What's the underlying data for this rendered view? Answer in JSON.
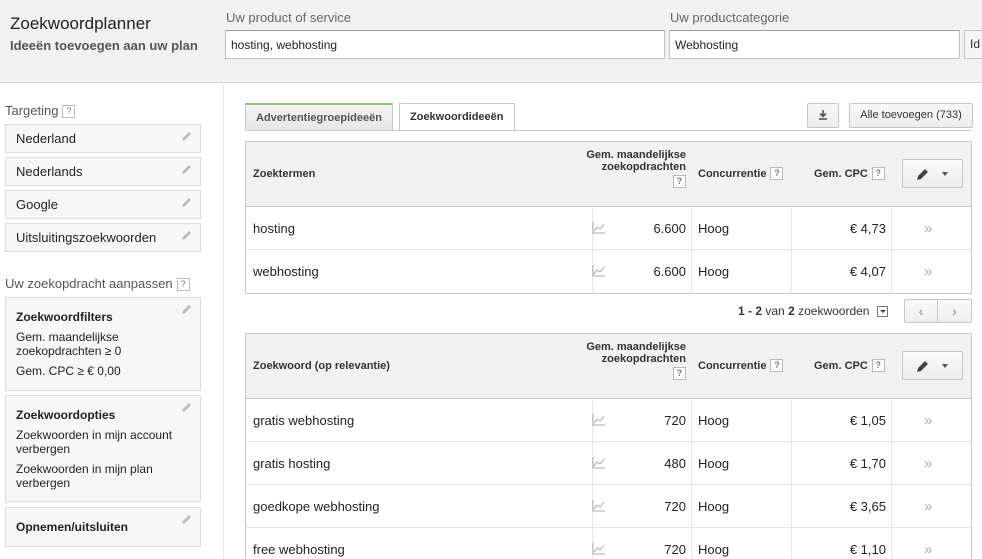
{
  "header": {
    "title": "Zoekwoordplanner",
    "subtitle": "Ideeën toevoegen aan uw plan",
    "product_label": "Uw product of service",
    "product_value": "hosting, webhosting",
    "category_label": "Uw productcategorie",
    "category_value": "Webhosting",
    "action_button": "Id"
  },
  "sidebar": {
    "targeting_heading": "Targeting",
    "help_glyph": "?",
    "targeting_items": [
      "Nederland",
      "Nederlands",
      "Google",
      "Uitsluitingszoekwoorden"
    ],
    "customize_heading": "Uw zoekopdracht aanpassen",
    "filters": {
      "title": "Zoekwoordfilters",
      "lines": [
        "Gem. maandelijkse zoekopdrachten ≥ 0",
        "Gem. CPC ≥ € 0,00"
      ]
    },
    "options": {
      "title": "Zoekwoordopties",
      "lines": [
        "Zoekwoorden in mijn account verbergen",
        "Zoekwoorden in mijn plan verbergen"
      ]
    },
    "include_exclude": "Opnemen/uitsluiten"
  },
  "tabs": [
    {
      "label": "Advertentiegroepideeën",
      "active": false
    },
    {
      "label": "Zoekwoordideeën",
      "active": true
    }
  ],
  "toolbar": {
    "add_all_label": "Alle toevoegen (733)"
  },
  "table_terms": {
    "col_term": "Zoektermen",
    "col_volume": "Gem. maandelijkse zoekopdrachten",
    "col_competition": "Concurrentie",
    "col_cpc": "Gem. CPC",
    "rows": [
      {
        "term": "hosting",
        "volume": "6.600",
        "competition": "Hoog",
        "cpc": "€ 4,73"
      },
      {
        "term": "webhosting",
        "volume": "6.600",
        "competition": "Hoog",
        "cpc": "€ 4,07"
      }
    ]
  },
  "pager": {
    "range": "1 - 2",
    "of": "van",
    "total": "2",
    "unit": "zoekwoorden",
    "prev": "‹",
    "next": "›"
  },
  "table_ideas": {
    "col_term": "Zoekwoord (op relevantie)",
    "col_volume": "Gem. maandelijkse zoekopdrachten",
    "col_competition": "Concurrentie",
    "col_cpc": "Gem. CPC",
    "rows": [
      {
        "term": "gratis webhosting",
        "volume": "720",
        "competition": "Hoog",
        "cpc": "€ 1,05"
      },
      {
        "term": "gratis hosting",
        "volume": "480",
        "competition": "Hoog",
        "cpc": "€ 1,70"
      },
      {
        "term": "goedkope webhosting",
        "volume": "720",
        "competition": "Hoog",
        "cpc": "€ 3,65"
      },
      {
        "term": "free webhosting",
        "volume": "720",
        "competition": "Hoog",
        "cpc": "€ 1,10"
      }
    ]
  },
  "add_glyph": "»",
  "colors": {
    "tab_accent": "#8cc27c",
    "header_bg": "#f1f1f1"
  }
}
